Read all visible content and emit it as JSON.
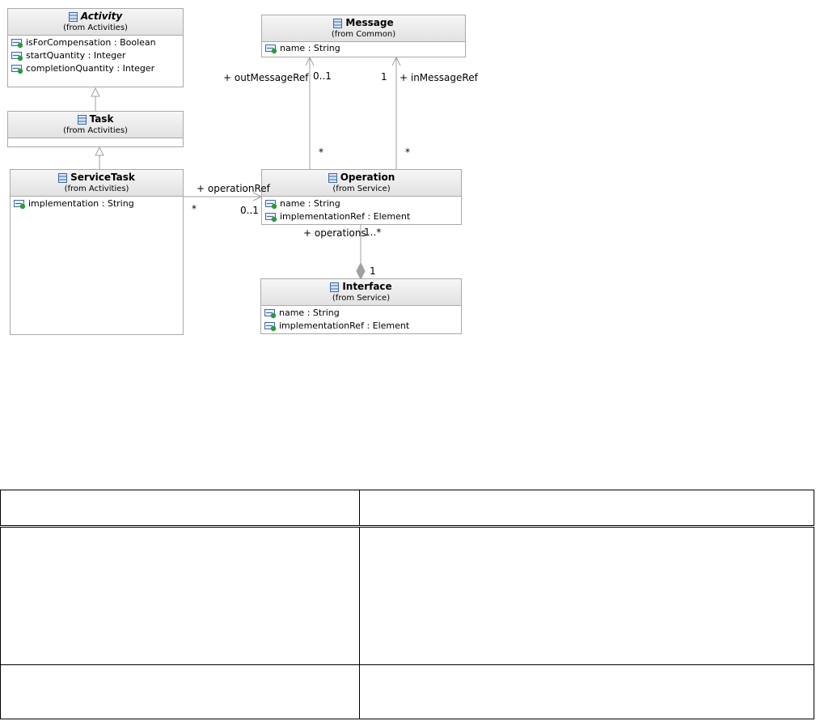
{
  "classes": {
    "activity": {
      "name": "Activity",
      "from": "(from Activities)",
      "attributes": [
        "isForCompensation : Boolean",
        "startQuantity : Integer",
        "completionQuantity : Integer"
      ]
    },
    "task": {
      "name": "Task",
      "from": "(from Activities)",
      "attributes": []
    },
    "service_task": {
      "name": "ServiceTask",
      "from": "(from Activities)",
      "attributes": [
        "implementation : String"
      ]
    },
    "message": {
      "name": "Message",
      "from": "(from Common)",
      "attributes": [
        "name : String"
      ]
    },
    "operation": {
      "name": "Operation",
      "from": "(from Service)",
      "attributes": [
        "name : String",
        "implementationRef : Element"
      ]
    },
    "interface": {
      "name": "Interface",
      "from": "(from Service)",
      "attributes": [
        "name : String",
        "implementationRef : Element"
      ]
    }
  },
  "associations": {
    "out_message_ref": {
      "role": "+ outMessageRef",
      "target_mult": "0..1",
      "source_mult": "*"
    },
    "in_message_ref": {
      "role": "+ inMessageRef",
      "target_mult": "1",
      "source_mult": "*"
    },
    "operation_ref": {
      "role": "+ operationRef",
      "target_mult": "0..1",
      "source_mult": "*"
    },
    "operations": {
      "role": "+ operations",
      "part_mult": "1..*",
      "whole_mult": "1"
    }
  },
  "colors": {
    "border": "#a9a9a9",
    "header_top": "#f6f6f6",
    "header_bottom": "#e2e2e2",
    "icon_blue": "#3d6aa8",
    "icon_green": "#2e9a3c"
  },
  "table": {
    "rows": [
      [
        "",
        ""
      ],
      [
        "",
        ""
      ],
      [
        "",
        ""
      ]
    ]
  }
}
